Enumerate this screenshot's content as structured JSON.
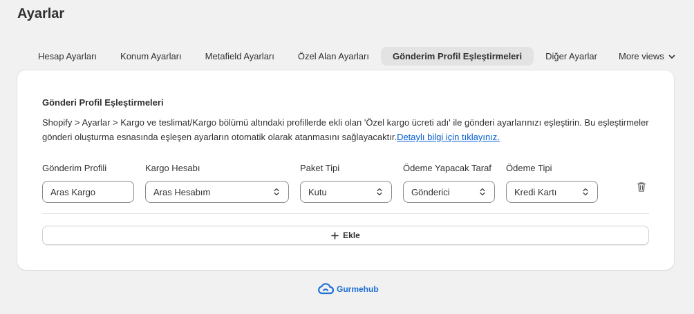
{
  "page": {
    "title": "Ayarlar"
  },
  "tabs": [
    {
      "label": "Hesap Ayarları",
      "active": false
    },
    {
      "label": "Konum Ayarları",
      "active": false
    },
    {
      "label": "Metafield Ayarları",
      "active": false
    },
    {
      "label": "Özel Alan Ayarları",
      "active": false
    },
    {
      "label": "Gönderim Profil Eşleştirmeleri",
      "active": true
    },
    {
      "label": "Diğer Ayarlar",
      "active": false
    }
  ],
  "more_views": {
    "label": "More views",
    "icon": "chevron-down-icon"
  },
  "card": {
    "title": "Gönderi Profil Eşleştirmeleri",
    "description": "Shopify > Ayarlar > Kargo ve teslimat/Kargo bölümü altındaki profillerde ekli olan 'Özel kargo ücreti adı' ile gönderi ayarlarınızı eşleştirin. Bu eşleştirmeler gönderi oluşturma esnasında eşleşen ayarların otomatik olarak atanmasını sağlayacaktır.",
    "link_text": "Detaylı bilgi için tıklayınız."
  },
  "columns": {
    "shipping_profile": {
      "label": "Gönderim Profili",
      "value": "Aras Kargo"
    },
    "cargo_account": {
      "label": "Kargo Hesabı",
      "value": "Aras Hesabım"
    },
    "package_type": {
      "label": "Paket Tipi",
      "value": "Kutu"
    },
    "payer": {
      "label": "Ödeme Yapacak Taraf",
      "value": "Gönderici"
    },
    "payment_type": {
      "label": "Ödeme Tipi",
      "value": "Kredi Kartı"
    }
  },
  "add_button": {
    "label": "Ekle",
    "icon": "plus-icon"
  },
  "footer": {
    "brand": "Gurmehub",
    "icon": "cloud-icon"
  },
  "colors": {
    "link": "#005bd3",
    "brand": "#1f6fd6",
    "active_tab_bg": "#e3e3e3"
  }
}
